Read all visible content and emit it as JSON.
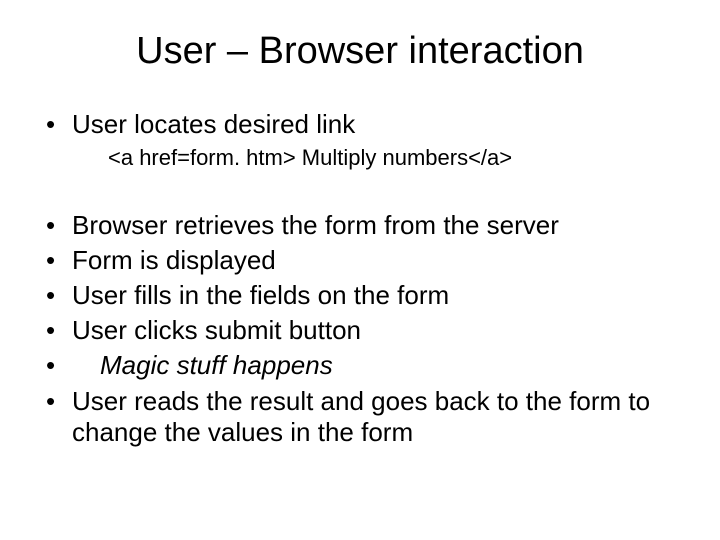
{
  "title": "User – Browser interaction",
  "bullets": {
    "b1": "User locates desired link",
    "b1sub": "<a href=form. htm> Multiply numbers</a>",
    "b2": "Browser retrieves the form from the server",
    "b3": "Form is displayed",
    "b4": "User fills in the fields on the form",
    "b5": "User clicks submit button",
    "b6": "Magic stuff happens",
    "b7": "User reads the result and goes back to the form to change the values in the form"
  }
}
